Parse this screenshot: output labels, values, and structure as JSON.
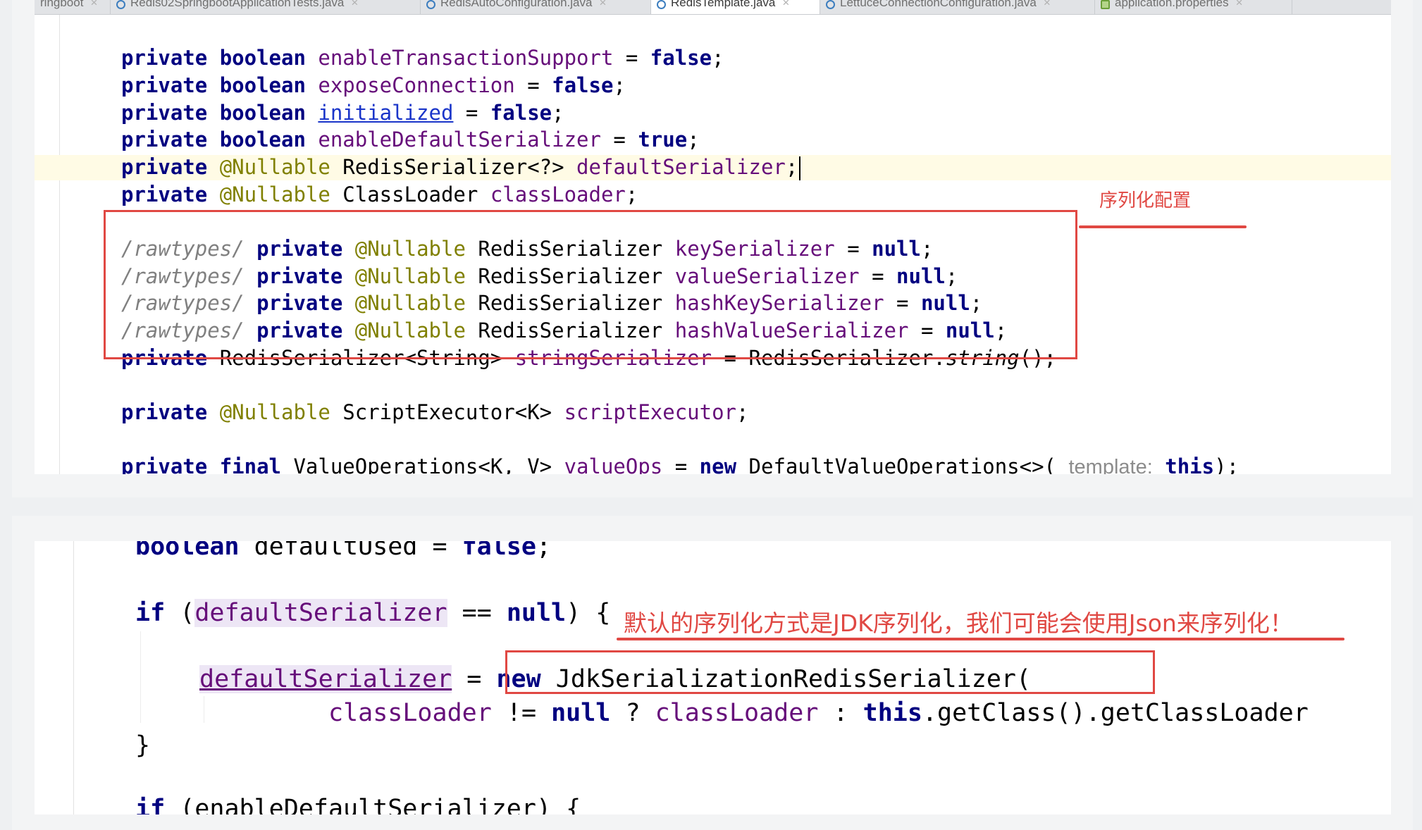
{
  "tabs": [
    {
      "label": "ringboot",
      "icon": "java-file-icon",
      "active": false
    },
    {
      "label": "Redis02SpringbootApplicationTests.java",
      "icon": "java-file-icon",
      "active": false
    },
    {
      "label": "RedisAutoConfiguration.java",
      "icon": "java-file-icon",
      "active": false
    },
    {
      "label": "RedisTemplate.java",
      "icon": "java-file-icon",
      "active": true
    },
    {
      "label": "LettuceConnectionConfiguration.java",
      "icon": "java-file-icon",
      "active": false
    },
    {
      "label": "application.properties",
      "icon": "properties-file-icon",
      "active": false
    }
  ],
  "tab_close_glyph": "×",
  "top_code": {
    "l1": {
      "kw1": "private",
      "kw2": "boolean",
      "field": "enableTransactionSupport",
      "op": " = ",
      "val": "false",
      "end": ";"
    },
    "l2": {
      "kw1": "private",
      "kw2": "boolean",
      "field": "exposeConnection",
      "op": " = ",
      "val": "false",
      "end": ";"
    },
    "l3": {
      "kw1": "private",
      "kw2": "boolean",
      "field": "initialized",
      "op": " = ",
      "val": "false",
      "end": ";"
    },
    "l4": {
      "kw1": "private",
      "kw2": "boolean",
      "field": "enableDefaultSerializer",
      "op": " = ",
      "val": "true",
      "end": ";"
    },
    "l5": {
      "kw1": "private",
      "ann": "@Nullable",
      "type": "RedisSerializer<?>",
      "field": "defaultSerializer",
      "end": ";"
    },
    "l6": {
      "kw1": "private",
      "ann": "@Nullable",
      "type": "ClassLoader",
      "field": "classLoader",
      "end": ";"
    },
    "l7": {
      "cmt": "/rawtypes/",
      "kw1": "private",
      "ann": "@Nullable",
      "type": "RedisSerializer",
      "field": "keySerializer",
      "op": " = ",
      "val": "null",
      "end": ";"
    },
    "l8": {
      "cmt": "/rawtypes/",
      "kw1": "private",
      "ann": "@Nullable",
      "type": "RedisSerializer",
      "field": "valueSerializer",
      "op": " = ",
      "val": "null",
      "end": ";"
    },
    "l9": {
      "cmt": "/rawtypes/",
      "kw1": "private",
      "ann": "@Nullable",
      "type": "RedisSerializer",
      "field": "hashKeySerializer",
      "op": " = ",
      "val": "null",
      "end": ";"
    },
    "l10": {
      "cmt": "/rawtypes/",
      "kw1": "private",
      "ann": "@Nullable",
      "type": "RedisSerializer",
      "field": "hashValueSerializer",
      "op": " = ",
      "val": "null",
      "end": ";"
    },
    "l11": {
      "kw1": "private",
      "type": "RedisSerializer<String>",
      "field": "stringSerializer",
      "op": " = ",
      "call": "RedisSerializer.",
      "method": "string",
      "end": "();"
    },
    "l12": {
      "kw1": "private",
      "ann": "@Nullable",
      "type": "ScriptExecutor<K>",
      "field": "scriptExecutor",
      "end": ";"
    },
    "l13": {
      "kw1": "private",
      "kw2": "final",
      "type": "ValueOperations<K, V>",
      "field": "valueOps",
      "op": " = ",
      "kw3": "new",
      "ctor": "DefaultValueOperations<>(",
      "hint": "template:",
      "kw4": "this",
      "end": ");"
    }
  },
  "bottom_code": {
    "b1": {
      "kw": "boolean",
      "rest": " defaultUsed = ",
      "val": "false",
      "end": ";"
    },
    "b2": {
      "kw": "if",
      "open": " (",
      "field": "defaultSerializer",
      "op": " == ",
      "val": "null",
      "end": ") {"
    },
    "b3": {
      "field": "defaultSerializer",
      "op": " = ",
      "kw": "new",
      "ctor": " JdkSerializationRedisSerializer("
    },
    "b4": {
      "field": "classLoader",
      "op": " != ",
      "val": "null",
      "q": " ? ",
      "field2": "classLoader",
      "colon": " : ",
      "kw": "this",
      "call": ".getClass().getClassLoader"
    },
    "b5": {
      "text": "}"
    },
    "b6": {
      "kw": "if",
      "rest": " (enableDefaultSerializer) {"
    }
  },
  "annotations": {
    "top_note": "序列化配置",
    "bottom_note": "默认的序列化方式是JDK序列化，我们可能会使用Json来序列化！"
  },
  "colors": {
    "keyword": "#000080",
    "field": "#660e7a",
    "annotation": "#808000",
    "comment": "#808080",
    "markup": "#e04843"
  }
}
